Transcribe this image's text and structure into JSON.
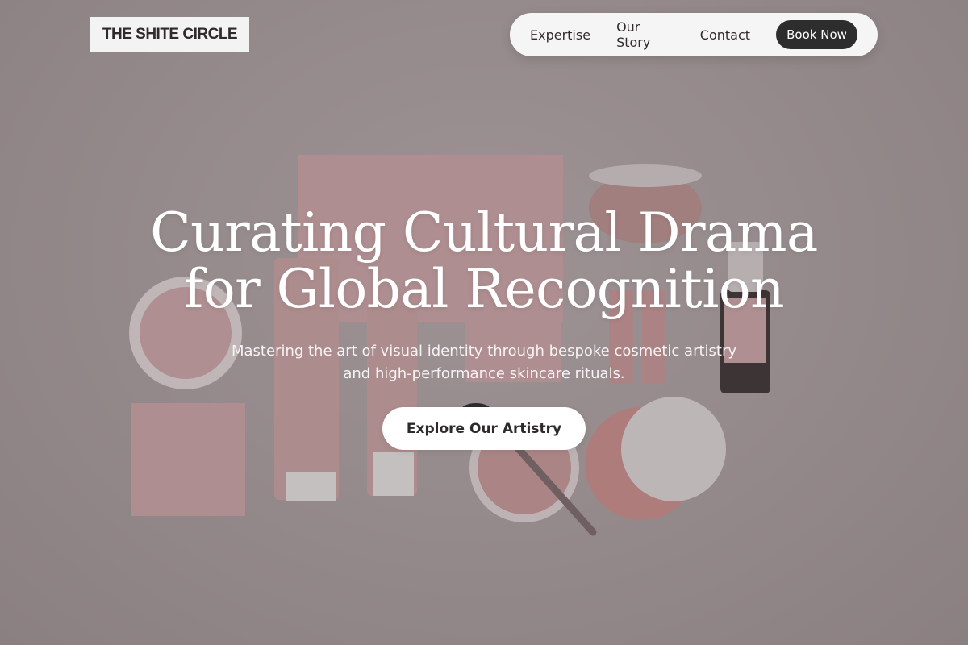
{
  "brand": {
    "logo_text": "THE SHITE CIRCLE"
  },
  "nav": {
    "items": [
      {
        "label": "Expertise"
      },
      {
        "label": "Our Story"
      },
      {
        "label": "Contact"
      }
    ],
    "book_button": "Book Now"
  },
  "hero": {
    "headline_line1": "Curating Cultural Drama",
    "headline_line2": "for Global Recognition",
    "subtitle_line1": "Mastering the art of visual identity through bespoke cosmetic artistry",
    "subtitle_line2": "and high-performance skincare rituals.",
    "cta_label": "Explore Our Artistry",
    "background_image": "cosmetic product flat lay"
  },
  "colors": {
    "background": "#a69b9d",
    "nav_bg": "#f6f5f5",
    "book_button_bg": "#2d2d2d",
    "cta_bg": "#ffffff",
    "headline_text": "#ffffff"
  }
}
